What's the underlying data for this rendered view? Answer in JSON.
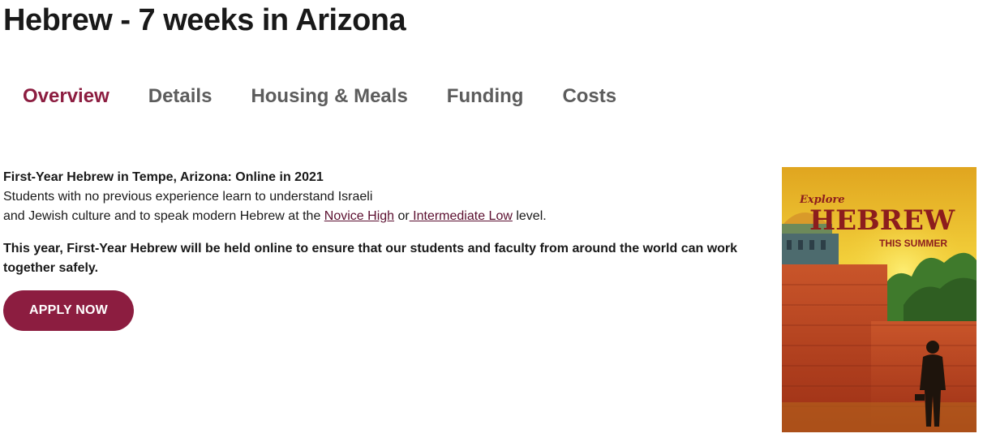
{
  "page": {
    "title": "Hebrew - 7 weeks in Arizona"
  },
  "tabs": [
    {
      "label": "Overview",
      "active": true
    },
    {
      "label": "Details",
      "active": false
    },
    {
      "label": "Housing & Meals",
      "active": false
    },
    {
      "label": "Funding",
      "active": false
    },
    {
      "label": "Costs",
      "active": false
    }
  ],
  "overview": {
    "heading": "First-Year Hebrew in Tempe, Arizona: Online in 2021",
    "line1": "Students with no previous experience learn to understand Israeli",
    "line2_prefix": "and Jewish culture and to speak modern Hebrew at the ",
    "link_novice": "Novice High",
    "connector": " or",
    "link_intermediate": " Intermediate Low",
    "line2_suffix": " level.",
    "notice": "This year, First-Year Hebrew will be held online to ensure that our students and faculty from around the world can work together safely.",
    "apply_label": "APPLY NOW"
  },
  "poster": {
    "explore": "Explore",
    "hebrew": "HEBREW",
    "this_summer": "THIS SUMMER"
  },
  "colors": {
    "accent": "#8c1d40",
    "tab_inactive": "#5c5c5c",
    "link": "#5b0f2f"
  }
}
